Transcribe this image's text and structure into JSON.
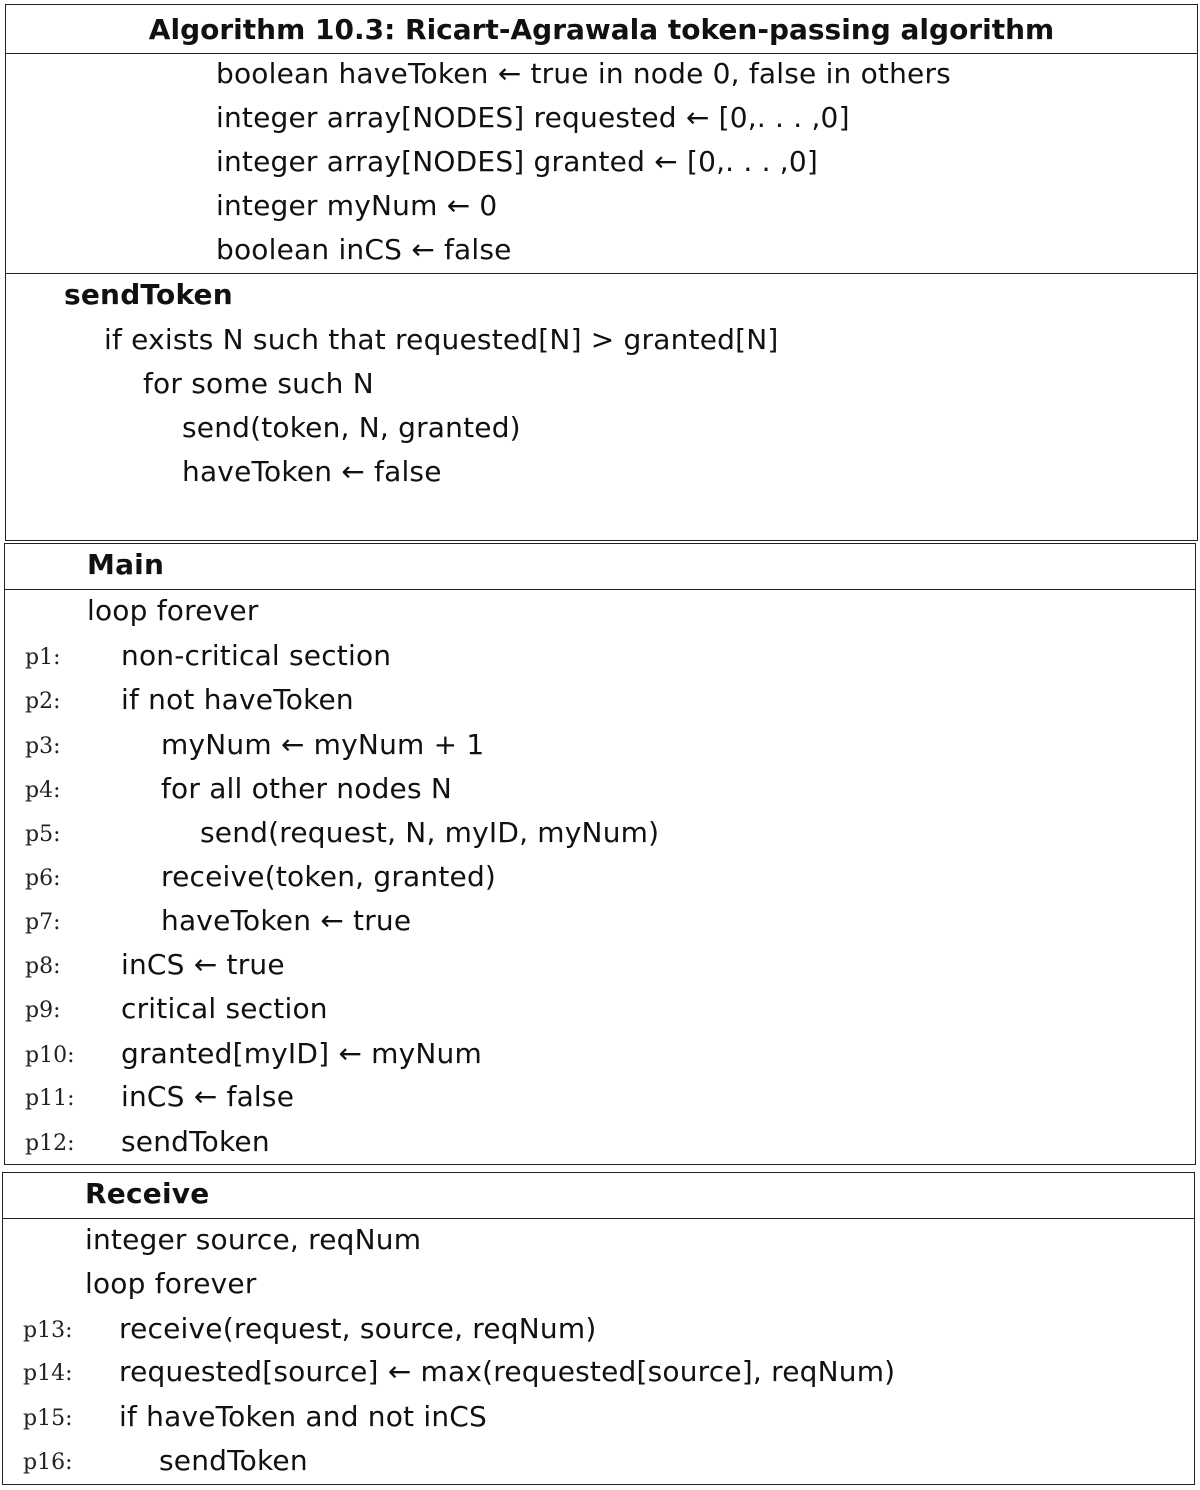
{
  "algorithm": {
    "title": "Algorithm 10.3: Ricart-Agrawala token-passing algorithm",
    "declarations": [
      "boolean haveToken ← true in node 0, false in others",
      "integer array[NODES] requested ← [0,. . . ,0]",
      "integer array[NODES] granted ← [0,. . . ,0]",
      "integer myNum ← 0",
      "boolean inCS ← false"
    ]
  },
  "send_token": {
    "heading": "sendToken",
    "lines": [
      "if exists N such that requested[N] > granted[N]",
      "for some such N",
      "send(token, N, granted)",
      "haveToken ← false"
    ]
  },
  "main": {
    "heading": "Main",
    "intro": "loop forever",
    "lines": [
      {
        "label": "p1:",
        "text": "non-critical section"
      },
      {
        "label": "p2:",
        "text": "if not haveToken"
      },
      {
        "label": "p3:",
        "text": "myNum ← myNum + 1"
      },
      {
        "label": "p4:",
        "text": "for all other nodes N"
      },
      {
        "label": "p5:",
        "text": "send(request, N, myID, myNum)"
      },
      {
        "label": "p6:",
        "text": "receive(token, granted)"
      },
      {
        "label": "p7:",
        "text": "haveToken ← true"
      },
      {
        "label": "p8:",
        "text": "inCS ← true"
      },
      {
        "label": "p9:",
        "text": "critical section"
      },
      {
        "label": "p10:",
        "text": "granted[myID] ← myNum"
      },
      {
        "label": "p11:",
        "text": "inCS ← false"
      },
      {
        "label": "p12:",
        "text": "sendToken"
      }
    ]
  },
  "receive": {
    "heading": "Receive",
    "decl": "integer source, reqNum",
    "intro": "loop forever",
    "lines": [
      {
        "label": "p13:",
        "text": "receive(request, source, reqNum)"
      },
      {
        "label": "p14:",
        "text": "requested[source] ← max(requested[source], reqNum)"
      },
      {
        "label": "p15:",
        "text": "if haveToken and not inCS"
      },
      {
        "label": "p16:",
        "text": "sendToken"
      }
    ]
  }
}
